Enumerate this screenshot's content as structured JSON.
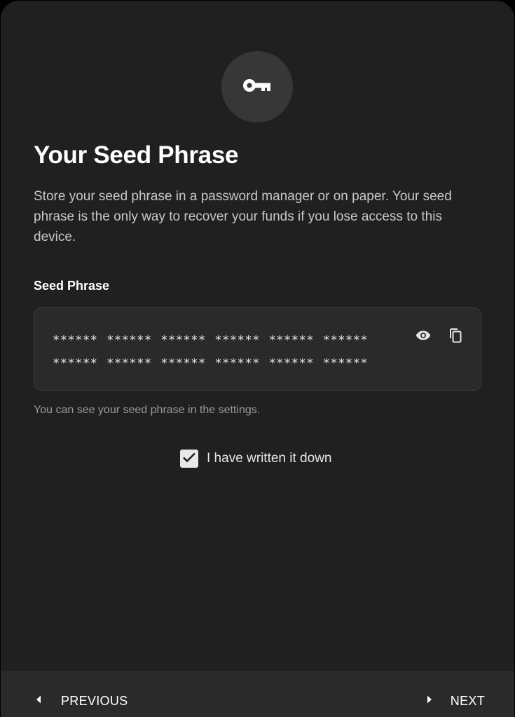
{
  "header": {
    "icon": "key-icon",
    "title": "Your Seed Phrase",
    "description": "Store your seed phrase in a password manager or on paper. Your seed phrase is the only way to recover your funds if you lose access to this device."
  },
  "seed": {
    "label": "Seed Phrase",
    "masked_words": "****** ****** ****** ****** ****** ****** ****** ****** ****** ****** ****** ******",
    "reveal_icon": "eye-icon",
    "copy_icon": "copy-icon",
    "hint": "You can see your seed phrase in the settings."
  },
  "confirm": {
    "label": "I have written it down",
    "checked": true
  },
  "footer": {
    "previous_label": "PREVIOUS",
    "next_label": "NEXT"
  },
  "colors": {
    "background": "#202020",
    "icon_circle": "#373737",
    "field_background": "#2a2a2a",
    "footer_background": "#2a2a2a",
    "text_primary": "#ffffff",
    "text_secondary": "#c8c8c8",
    "text_muted": "#9a9a9a"
  }
}
